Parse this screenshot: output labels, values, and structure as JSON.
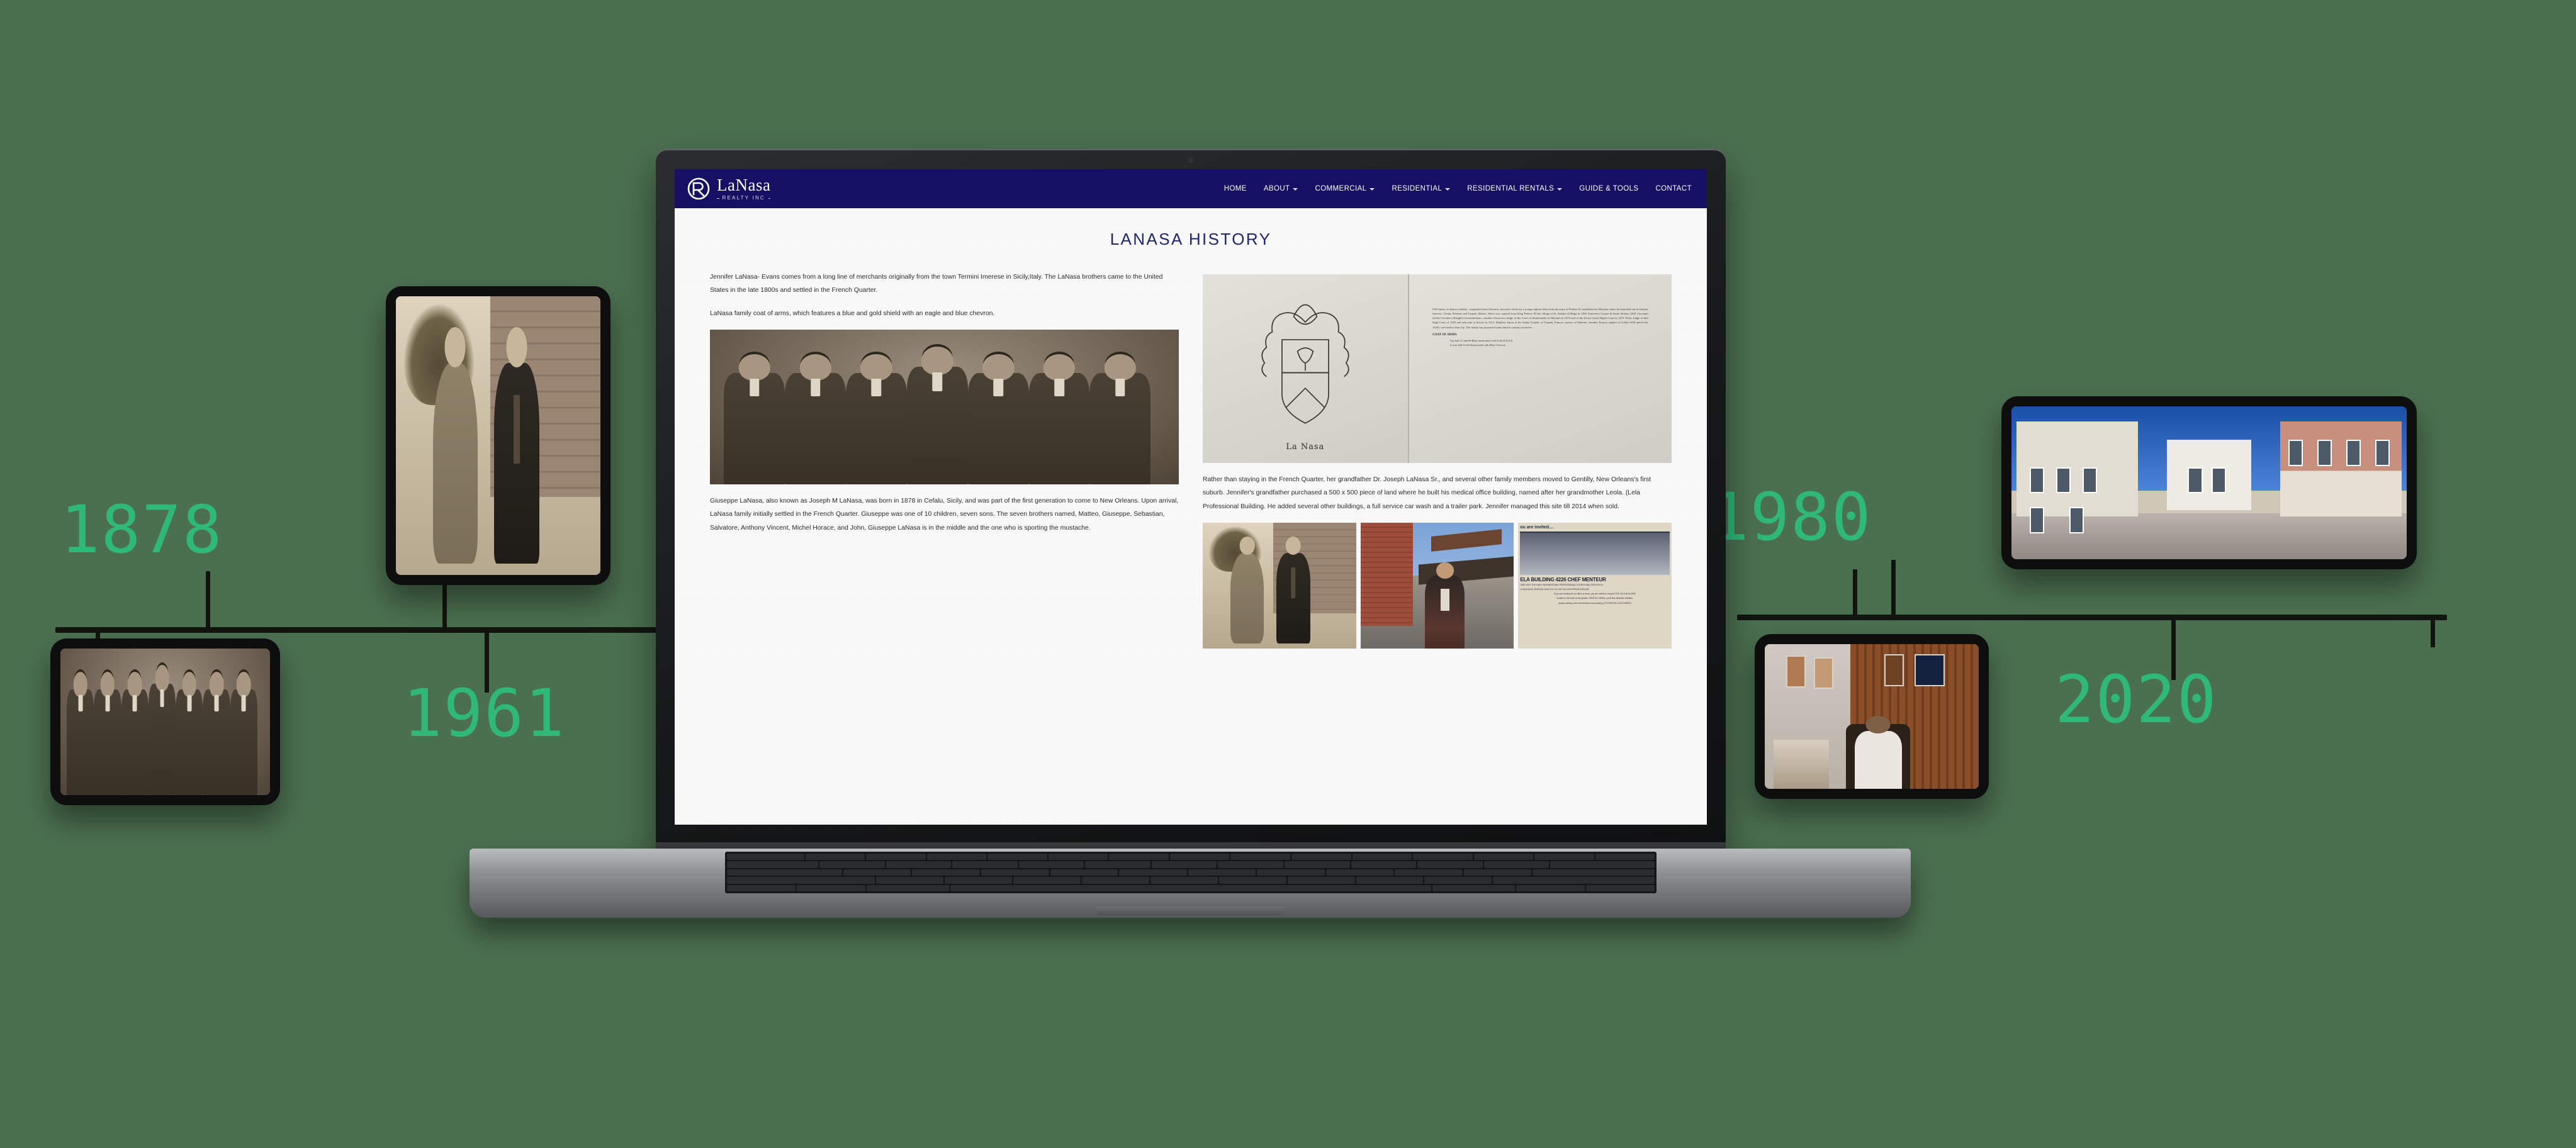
{
  "background_color": "#4b7050",
  "accent_color": "#2fb878",
  "timeline": {
    "milestones": [
      {
        "year": "1878",
        "device": "tablet",
        "caption_photo": "seven-brothers-portrait"
      },
      {
        "year": "1961",
        "device": "tablet",
        "caption_photo": "couple-outside-house"
      },
      {
        "year": "1980",
        "device": "tablet",
        "caption_photo": "man-at-office-desk"
      },
      {
        "year": "2020",
        "device": "tablet",
        "caption_photo": "three-new-orleans-buildings"
      }
    ]
  },
  "laptop": {
    "site": {
      "navbar": {
        "logo": {
          "word": "LaNasa",
          "subtitle": "REALTY INC",
          "mark": "lanasa-monogram-icon"
        },
        "nav_items": [
          {
            "label": "HOME",
            "has_dropdown": false
          },
          {
            "label": "ABOUT",
            "has_dropdown": true
          },
          {
            "label": "COMMERCIAL",
            "has_dropdown": true
          },
          {
            "label": "RESIDENTIAL",
            "has_dropdown": true
          },
          {
            "label": "RESIDENTIAL RENTALS",
            "has_dropdown": true
          },
          {
            "label": "GUIDE & TOOLS",
            "has_dropdown": false
          },
          {
            "label": "CONTACT",
            "has_dropdown": false
          }
        ]
      },
      "page_title": "LANASA HISTORY",
      "left_column": {
        "p1": "Jennifer LaNasa- Evans comes from a long line of merchants originally from the town Termini Imerese in Sicily,Italy. The LaNasa brothers came to the United States in the late 1800s and settled in the French Quarter.",
        "p2": "LaNasa family coat of arms, which features a blue and gold shield with an eagle and blue chevron.",
        "figure_alt": "Seven LaNasa brothers group portrait, sepia",
        "p3": "Giuseppe LaNasa, also known as Joseph M LaNasa, was born in 1878 in Cefalu, Sicily, and was part of the first generation to come to New Orleans. Upon arrival, LaNasa family initially settled in the French Quarter.  Giuseppe was one of 10 children, seven sons. The seven brothers named, Matteo, Giuseppe, Sebastian, Salvatore, Anthony Vincent, Michel Horace, and John, Giuseppe LaNasa is in the middle and the one who is sporting the mustache."
      },
      "right_column": {
        "figure_alt": "Scanned LaNasa coat of arms document",
        "coat_of_arms": {
          "caption": "La Nasa",
          "body": "Old family of distinct nobility , originated from Florence, moved to Sicily by a young captain John from the army of Federic II, established in Messina where he branched out in Termini Imerese, Cefalu, Palermo and Trapani. Robert, John's son, aquired from King Federic III the village of St. Stefano di Briga in 1366. Francesco Carone di Santo Stefano 1416. Giovanni (John) Cavaliere (Knight) Gerosalimitano—another Francesco Judge of the Court of Straticoziale of Messina in 1474 and of the (Gran Corte) Highe Court in 1475. Peter, Judge of that High Court of 1503 and advocate or lawyer in 1513. Matthew baron of the Saline Grande, of Trapani, Francis, senator of Palermo. Another Francis captain of Cefalu 1618 and in the 1620's was head of that city. The family has possessed some land in various territories.",
          "arms_heading": "COAT OF ARMS:",
          "arms_line1": "Top half of shield=Blue backround with Gold EAGLE",
          "arms_line2": "Lower half=Gold backround with Blue Chevron"
        },
        "p1": "Rather than staying in the French Quarter, her grandfather Dr. Joseph LaNasa Sr., and several other family members moved to Gentilly, New Orleans's first suburb. Jennifer's grandfather purchased a 500 x 500 piece of land where he built his medical office building, named after her grandmother Leola. (Lela Professional Building. He added several other buildings, a full service car wash and a trailer park. Jennifer managed this site till 2014 when sold.",
        "gallery": [
          {
            "alt": "Couple in front of house 4021"
          },
          {
            "alt": "Man standing outside brick building"
          },
          {
            "alt": "Newspaper clipping advertisement",
            "clipping": {
              "kicker": "ou are invited....",
              "headline": "ELA BUILDING 4226 CHEF MENTEUR",
              "line1": "OME VISIT THE MANY BUSINESS AND PROFESSIONAL STORES AND OFFICES IN",
              "line2": "LA BUILDING  SERVING GENTILLY IN THE LELA SHOPPING AREA AR",
              "line3": "If you are looking for an office or store, you are invited to inspect THE LELA BUILDING",
              "line4": "located in the heart of the greater GENTILLY AREA, you'll find attractive facilities,",
              "line5": "ample parking, and a tremendous surrounding of POTENTIAL CUSTOMERS"
            }
          }
        ]
      }
    }
  }
}
